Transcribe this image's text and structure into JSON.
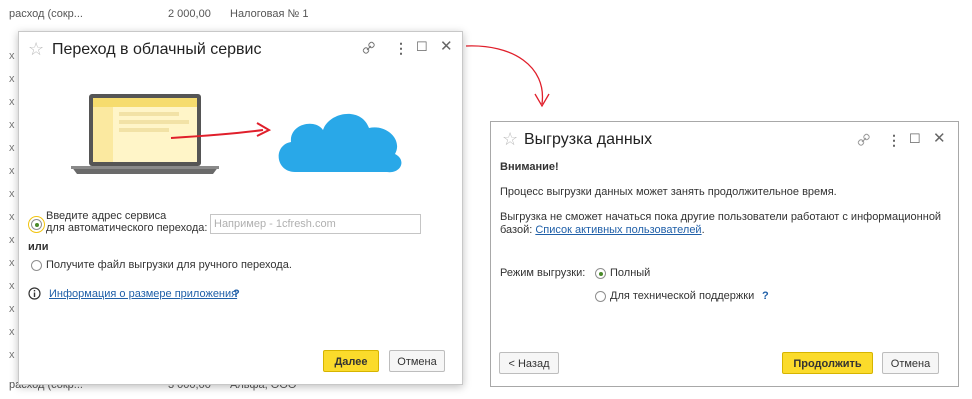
{
  "background_list": {
    "top_row": {
      "c1": "расход (сокр...",
      "c2": "2 000,00",
      "c3": "Налоговая № 1"
    },
    "bottom_row": {
      "c1": "расход (сокр...",
      "c2": "3 000,00",
      "c3": "Альфа, ООО"
    },
    "row_marker": "х"
  },
  "dialog1": {
    "title": "Переход в облачный сервис",
    "option_address_label_line1": "Введите адрес сервиса",
    "option_address_label_line2": "для автоматического перехода:",
    "address_input": {
      "value": "",
      "placeholder": "Например - 1cfresh.com"
    },
    "or_label": "или",
    "option_file_label": "Получите файл выгрузки для ручного перехода.",
    "info_link": "Информация о размере приложения",
    "help_mark": "?",
    "next_button": "Далее",
    "cancel_button": "Отмена"
  },
  "dialog2": {
    "title": "Выгрузка данных",
    "warning_title": "Внимание!",
    "line1": "Процесс выгрузки данных может занять продолжительное время.",
    "line2a": "Выгрузка не сможет начаться пока другие пользователи работают с информационной",
    "line2b": "базой:",
    "active_users_link": "Список активных пользователей",
    "line2c": ".",
    "mode_label": "Режим выгрузки:",
    "mode_full": "Полный",
    "mode_support": "Для технической поддержки",
    "help_mark": "?",
    "back_button": "< Назад",
    "continue_button": "Продолжить",
    "cancel_button": "Отмена"
  },
  "colors": {
    "primary_button": "#fbdb2b",
    "cloud": "#29a8e8",
    "arrow": "#e01f2b",
    "link": "#1f5fa8"
  }
}
